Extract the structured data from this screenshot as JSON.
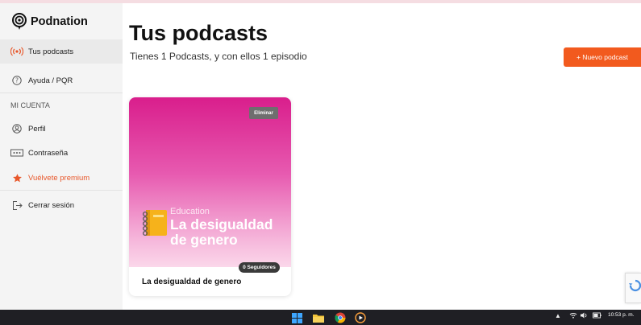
{
  "app": {
    "name": "Podnation"
  },
  "sidebar": {
    "items": [
      {
        "label": "Tus podcasts",
        "icon": "broadcast-icon"
      },
      {
        "label": "Ayuda / PQR",
        "icon": "help-circle-icon"
      }
    ],
    "section_label": "MI CUENTA",
    "account_items": [
      {
        "label": "Perfil",
        "icon": "user-icon"
      },
      {
        "label": "Contraseña",
        "icon": "password-icon"
      },
      {
        "label": "Vuélvete premium",
        "icon": "star-icon"
      },
      {
        "label": "Cerrar sesión",
        "icon": "logout-icon"
      }
    ]
  },
  "main": {
    "title": "Tus podcasts",
    "subtitle": "Tienes 1 Podcasts, y con ellos 1 episodio",
    "new_button": "+ Nuevo podcast"
  },
  "podcasts": [
    {
      "category": "Education",
      "cover_title": "La desigualdad de genero",
      "delete_label": "Eliminar",
      "followers": "0 Seguidores",
      "name": "La desigualdad de genero"
    }
  ],
  "taskbar": {
    "time": "10:53 p. m."
  },
  "colors": {
    "accent": "#f25a1e",
    "premium": "#e8572a",
    "cover_top": "#d91e8c",
    "cover_bottom": "#fbd7ea"
  }
}
